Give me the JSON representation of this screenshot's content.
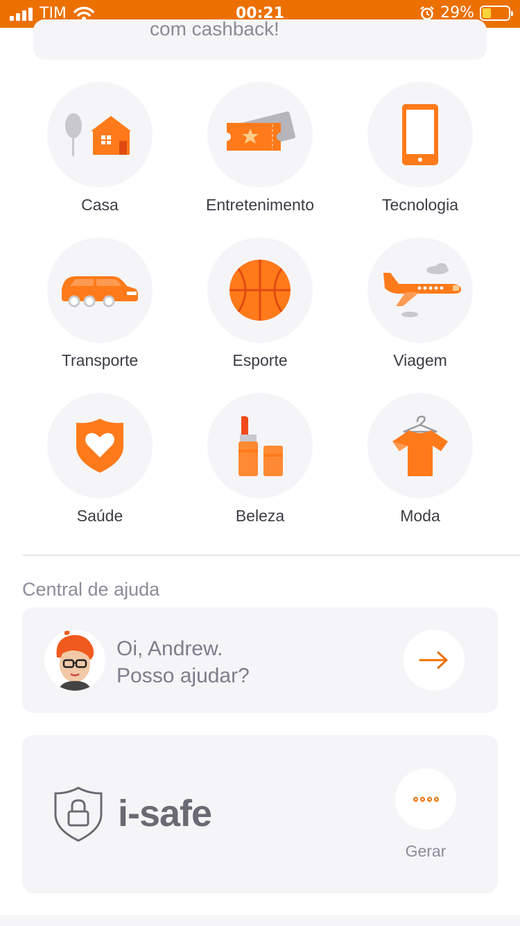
{
  "status_bar": {
    "carrier": "TIM",
    "time": "00:21",
    "battery": "29%"
  },
  "promo": {
    "text": "com cashback!"
  },
  "categories": [
    {
      "label": "Casa",
      "icon": "house-icon"
    },
    {
      "label": "Entretenimento",
      "icon": "ticket-icon"
    },
    {
      "label": "Tecnologia",
      "icon": "smartphone-icon"
    },
    {
      "label": "Transporte",
      "icon": "van-icon"
    },
    {
      "label": "Esporte",
      "icon": "basketball-icon"
    },
    {
      "label": "Viagem",
      "icon": "airplane-icon"
    },
    {
      "label": "Saúde",
      "icon": "heart-shield-icon"
    },
    {
      "label": "Beleza",
      "icon": "lipstick-icon"
    },
    {
      "label": "Moda",
      "icon": "tshirt-icon"
    }
  ],
  "help": {
    "title": "Central de ajuda",
    "line1": "Oi, Andrew.",
    "line2": "Posso ajudar?"
  },
  "isafe": {
    "name": "i-safe",
    "generate_label": "Gerar"
  },
  "colors": {
    "accent": "#ec7000",
    "icon_orange": "#ff7a1a",
    "card_bg": "#f5f5f8"
  }
}
